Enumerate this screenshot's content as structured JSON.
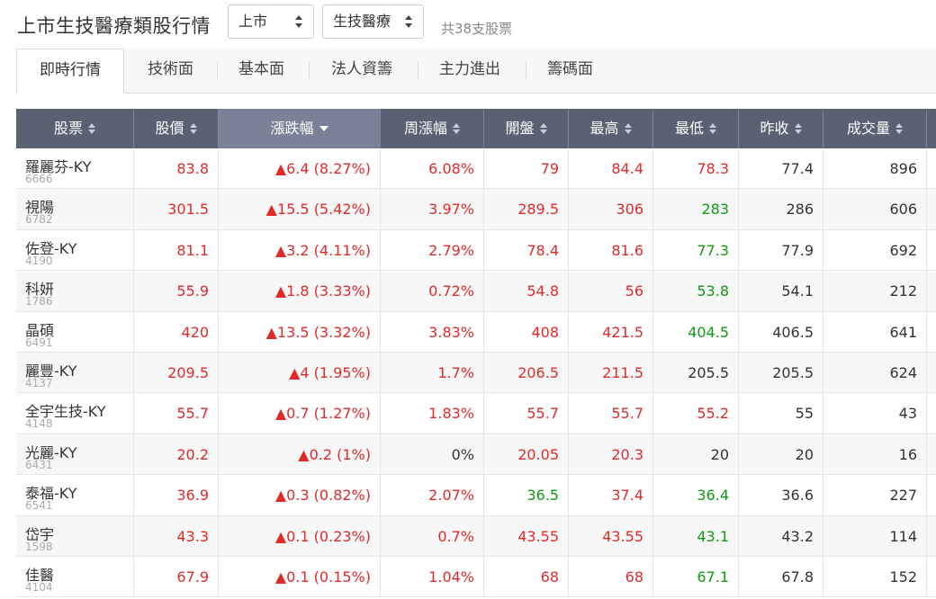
{
  "header": {
    "title": "上市生技醫療類股行情",
    "market_select": "上市",
    "industry_select": "生技醫療",
    "count_text": "共38支股票"
  },
  "tabs": [
    "即時行情",
    "技術面",
    "基本面",
    "法人資籌",
    "主力進出",
    "籌碼面"
  ],
  "columns": [
    "股票",
    "股價",
    "漲跌幅",
    "周漲幅",
    "開盤",
    "最高",
    "最低",
    "昨收",
    "成交量"
  ],
  "sorted_column": "漲跌幅",
  "colors": {
    "up": "#e02a2a",
    "down": "#119911",
    "header_bg": "#5a6173"
  },
  "rows": [
    {
      "name": "羅麗芬-KY",
      "code": "6666",
      "price": "83.8",
      "change": "▲6.4  (8.27%)",
      "week": "6.08%",
      "open": "79",
      "high": "84.4",
      "low": "78.3",
      "prev": "77.4",
      "volume": "896",
      "c": {
        "price": "up",
        "change": "up",
        "week": "up",
        "open": "up",
        "high": "up",
        "low": "up"
      }
    },
    {
      "name": "視陽",
      "code": "6782",
      "price": "301.5",
      "change": "▲15.5  (5.42%)",
      "week": "3.97%",
      "open": "289.5",
      "high": "306",
      "low": "283",
      "prev": "286",
      "volume": "606",
      "c": {
        "price": "up",
        "change": "up",
        "week": "up",
        "open": "up",
        "high": "up",
        "low": "down"
      }
    },
    {
      "name": "佐登-KY",
      "code": "4190",
      "price": "81.1",
      "change": "▲3.2  (4.11%)",
      "week": "2.79%",
      "open": "78.4",
      "high": "81.6",
      "low": "77.3",
      "prev": "77.9",
      "volume": "692",
      "c": {
        "price": "up",
        "change": "up",
        "week": "up",
        "open": "up",
        "high": "up",
        "low": "down"
      }
    },
    {
      "name": "科妍",
      "code": "1786",
      "price": "55.9",
      "change": "▲1.8  (3.33%)",
      "week": "0.72%",
      "open": "54.8",
      "high": "56",
      "low": "53.8",
      "prev": "54.1",
      "volume": "212",
      "c": {
        "price": "up",
        "change": "up",
        "week": "up",
        "open": "up",
        "high": "up",
        "low": "down"
      }
    },
    {
      "name": "晶碩",
      "code": "6491",
      "price": "420",
      "change": "▲13.5  (3.32%)",
      "week": "3.83%",
      "open": "408",
      "high": "421.5",
      "low": "404.5",
      "prev": "406.5",
      "volume": "641",
      "c": {
        "price": "up",
        "change": "up",
        "week": "up",
        "open": "up",
        "high": "up",
        "low": "down"
      }
    },
    {
      "name": "麗豐-KY",
      "code": "4137",
      "price": "209.5",
      "change": "▲4  (1.95%)",
      "week": "1.7%",
      "open": "206.5",
      "high": "211.5",
      "low": "205.5",
      "prev": "205.5",
      "volume": "624",
      "c": {
        "price": "up",
        "change": "up",
        "week": "up",
        "open": "up",
        "high": "up",
        "low": "flat"
      }
    },
    {
      "name": "全宇生技-KY",
      "code": "4148",
      "price": "55.7",
      "change": "▲0.7  (1.27%)",
      "week": "1.83%",
      "open": "55.7",
      "high": "55.7",
      "low": "55.2",
      "prev": "55",
      "volume": "43",
      "c": {
        "price": "up",
        "change": "up",
        "week": "up",
        "open": "up",
        "high": "up",
        "low": "up"
      }
    },
    {
      "name": "光麗-KY",
      "code": "6431",
      "price": "20.2",
      "change": "▲0.2  (1%)",
      "week": "0%",
      "open": "20.05",
      "high": "20.3",
      "low": "20",
      "prev": "20",
      "volume": "16",
      "c": {
        "price": "up",
        "change": "up",
        "week": "flat",
        "open": "up",
        "high": "up",
        "low": "flat"
      }
    },
    {
      "name": "泰福-KY",
      "code": "6541",
      "price": "36.9",
      "change": "▲0.3  (0.82%)",
      "week": "2.07%",
      "open": "36.5",
      "high": "37.4",
      "low": "36.4",
      "prev": "36.6",
      "volume": "227",
      "c": {
        "price": "up",
        "change": "up",
        "week": "up",
        "open": "down",
        "high": "up",
        "low": "down"
      }
    },
    {
      "name": "岱宇",
      "code": "1598",
      "price": "43.3",
      "change": "▲0.1  (0.23%)",
      "week": "0.7%",
      "open": "43.55",
      "high": "43.55",
      "low": "43.1",
      "prev": "43.2",
      "volume": "114",
      "c": {
        "price": "up",
        "change": "up",
        "week": "up",
        "open": "up",
        "high": "up",
        "low": "down"
      }
    },
    {
      "name": "佳醫",
      "code": "4104",
      "price": "67.9",
      "change": "▲0.1  (0.15%)",
      "week": "1.04%",
      "open": "68",
      "high": "68",
      "low": "67.1",
      "prev": "67.8",
      "volume": "152",
      "c": {
        "price": "up",
        "change": "up",
        "week": "up",
        "open": "up",
        "high": "up",
        "low": "down"
      }
    }
  ]
}
